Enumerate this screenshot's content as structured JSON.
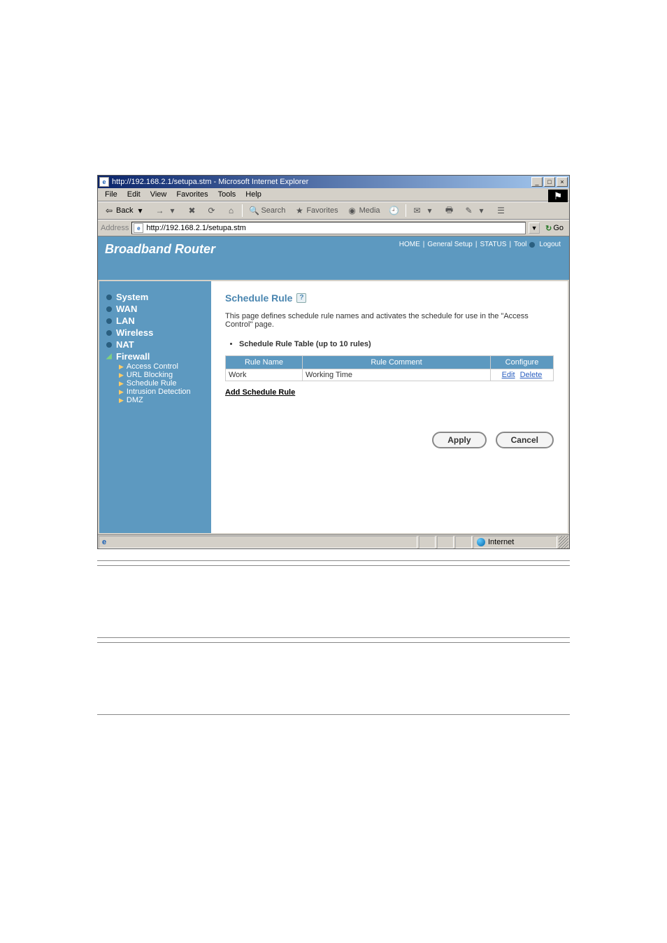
{
  "window": {
    "title": "http://192.168.2.1/setupa.stm - Microsoft Internet Explorer",
    "minimize": "_",
    "maximize": "□",
    "close": "×"
  },
  "menubar": {
    "file": "File",
    "edit": "Edit",
    "view": "View",
    "favorites": "Favorites",
    "tools": "Tools",
    "help": "Help"
  },
  "toolbar": {
    "back": "Back",
    "search": "Search",
    "favorites": "Favorites",
    "media": "Media"
  },
  "addressbar": {
    "label": "Address",
    "url": "http://192.168.2.1/setupa.stm",
    "go": "Go"
  },
  "header": {
    "brand": "Broadband Router",
    "nav": {
      "home": "HOME",
      "general_setup": "General Setup",
      "status": "STATUS",
      "tool": "Tool",
      "logout": "Logout"
    }
  },
  "sidebar": {
    "system": "System",
    "wan": "WAN",
    "lan": "LAN",
    "wireless": "Wireless",
    "nat": "NAT",
    "firewall": "Firewall",
    "sub": {
      "access_control": "Access Control",
      "url_blocking": "URL Blocking",
      "schedule_rule": "Schedule Rule",
      "intrusion_detection": "Intrusion Detection",
      "dmz": "DMZ"
    }
  },
  "panel": {
    "title": "Schedule Rule",
    "help_glyph": "?",
    "desc": "This page defines schedule rule names and activates the schedule for use in the \"Access Control\" page.",
    "table_caption": "Schedule Rule Table (up to 10 rules)",
    "columns": {
      "rule_name": "Rule Name",
      "rule_comment": "Rule Comment",
      "configure": "Configure"
    },
    "rows": [
      {
        "name": "Work",
        "comment": "Working Time",
        "edit": "Edit",
        "delete": "Delete"
      }
    ],
    "add_link": "Add Schedule Rule",
    "apply": "Apply",
    "cancel": "Cancel"
  },
  "statusbar": {
    "zone": "Internet"
  }
}
